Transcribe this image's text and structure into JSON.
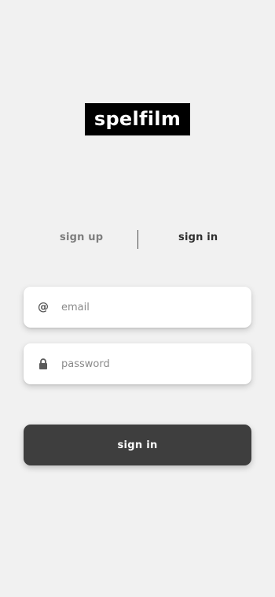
{
  "app": {
    "logo_text": "spelfilm"
  },
  "tabs": {
    "sign_up_label": "sign up",
    "sign_in_label": "sign in",
    "active": "sign in"
  },
  "form": {
    "email": {
      "icon": "at-icon",
      "placeholder": "email",
      "value": ""
    },
    "password": {
      "icon": "lock-icon",
      "placeholder": "password",
      "value": ""
    },
    "submit_label": "sign in"
  },
  "colors": {
    "background": "#f1f1f1",
    "logo_background": "#000000",
    "button_background": "#3e3e3e",
    "field_background": "#ffffff"
  }
}
